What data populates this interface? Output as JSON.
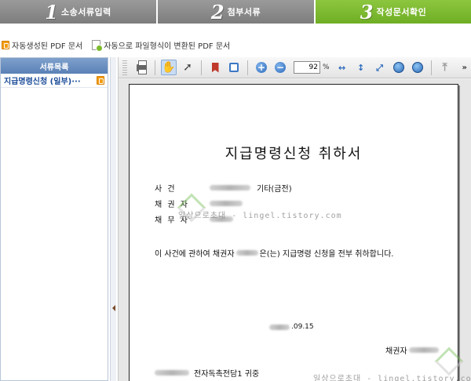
{
  "steps": [
    {
      "number": "1",
      "label": "소송서류입력"
    },
    {
      "number": "2",
      "label": "첨부서류"
    },
    {
      "number": "3",
      "label": "작성문서확인"
    }
  ],
  "doc_links": {
    "auto_pdf": "자동생성된 PDF 문서",
    "converted_pdf": "자동으로 파일형식이 변환된 PDF 문서"
  },
  "sidebar": {
    "header": "서류목록",
    "items": [
      {
        "label": "지급명령신청 (일부)···"
      }
    ]
  },
  "toolbar": {
    "zoom_value": "92",
    "zoom_unit": "%",
    "more": "»"
  },
  "document": {
    "title": "지급명령신청 취하서",
    "case_label": "사     건",
    "case_value": "기타(금전)",
    "creditor_label": "채  권  자",
    "debtor_label": "채  무  자",
    "body_prefix": "이 사건에 관하여 채권자",
    "body_suffix": "은(는) 지급명령 신청을 전부 취하합니다.",
    "date_suffix": ".09.15",
    "signature_label": "채권자",
    "court_suffix": "전자독촉전담1 귀중"
  },
  "watermark": {
    "text": "일상으로초대 - lingel.tistory.com"
  },
  "colors": {
    "step_active": "#7cbb2c",
    "step_inactive": "#8a8a8a",
    "sidebar_header": "#6a8fc2",
    "sidebar_item_text": "#1a4b99"
  }
}
